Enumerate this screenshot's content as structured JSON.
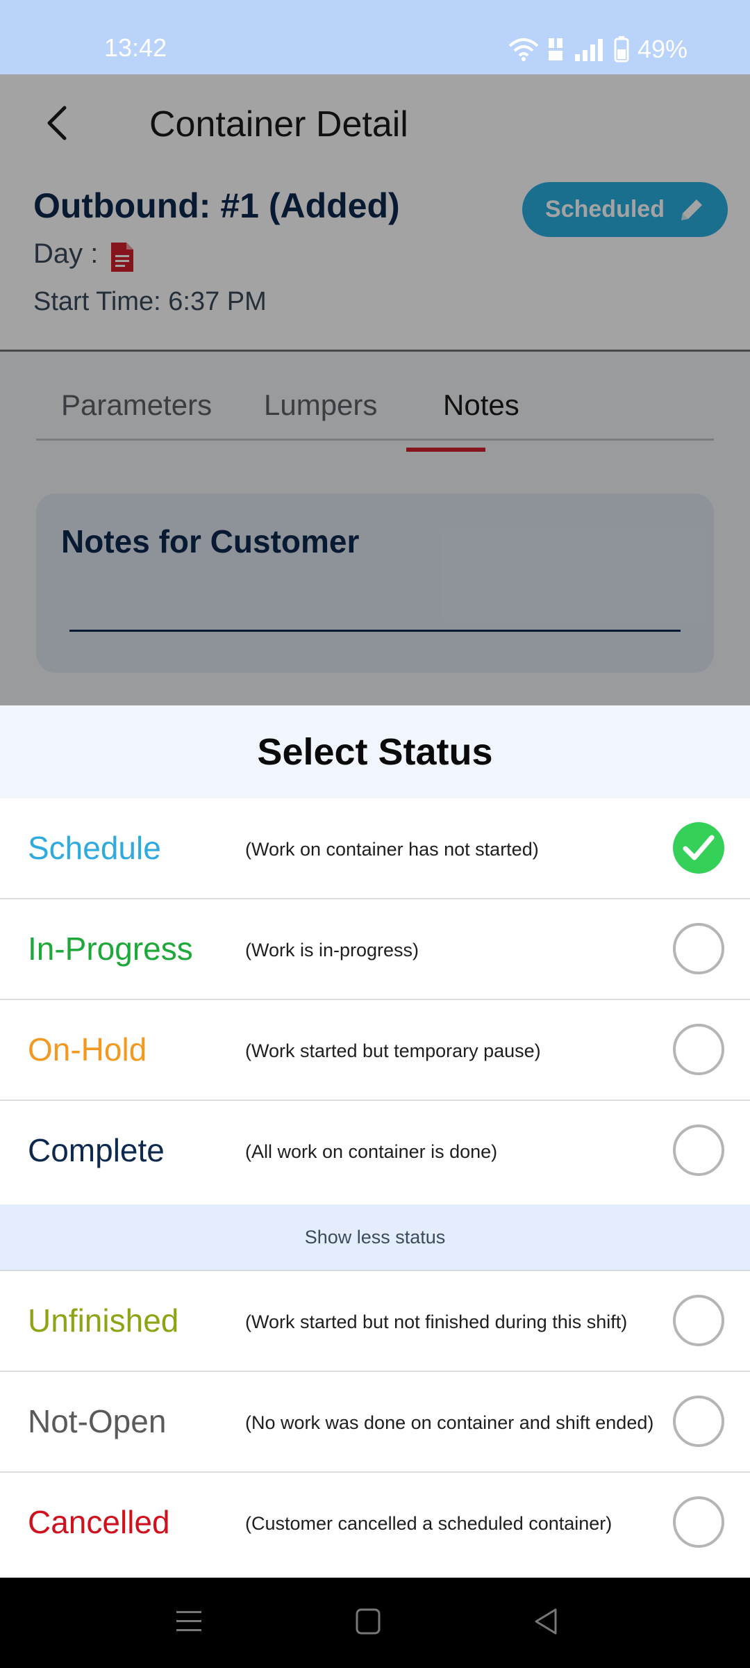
{
  "status_bar": {
    "time": "13:42",
    "battery": "49%"
  },
  "header": {
    "title": "Container Detail",
    "outbound": "Outbound: #1 (Added)",
    "day_label": "Day :",
    "start_time": "Start Time: 6:37 PM",
    "status_button": "Scheduled"
  },
  "tabs": [
    {
      "label": "Parameters",
      "active": false
    },
    {
      "label": "Lumpers",
      "active": false
    },
    {
      "label": "Notes",
      "active": true
    }
  ],
  "notes": {
    "title": "Notes for Customer",
    "value": ""
  },
  "sheet": {
    "title": "Select Status",
    "statuses": [
      {
        "name": "Schedule",
        "desc": "(Work on container has not started)",
        "color": "#2eaadf",
        "selected": true
      },
      {
        "name": "In-Progress",
        "desc": "(Work is in-progress)",
        "color": "#1ea83a",
        "selected": false
      },
      {
        "name": "On-Hold",
        "desc": "(Work started but temporary pause)",
        "color": "#f29a1f",
        "selected": false
      },
      {
        "name": "Complete",
        "desc": "(All work on container is done)",
        "color": "#0d2a4e",
        "selected": false
      }
    ],
    "show_less": "Show less status",
    "more_statuses": [
      {
        "name": "Unfinished",
        "desc": "(Work started but not finished during this shift)",
        "color": "#8fa415",
        "selected": false
      },
      {
        "name": "Not-Open",
        "desc": "(No work was done on container and shift ended)",
        "color": "#5a5a5a",
        "selected": false
      },
      {
        "name": "Cancelled",
        "desc": "(Customer cancelled a scheduled container)",
        "color": "#d0111d",
        "selected": false
      }
    ]
  },
  "colors": {
    "accent": "#2aaee0",
    "tab_indicator": "#d0202c",
    "check_green": "#34d058"
  }
}
